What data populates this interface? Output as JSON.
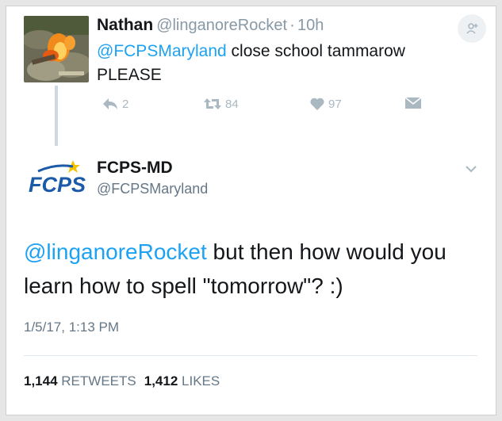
{
  "reply": {
    "name": "Nathan",
    "handle": "@linganoreRocket",
    "separator": "·",
    "time": "10h",
    "mention": "@FCPSMaryland",
    "text": " close school tammarow PLEASE",
    "reply_count": "2",
    "retweet_count": "84",
    "like_count": "97"
  },
  "tweet": {
    "name": "FCPS-MD",
    "handle": "@FCPSMaryland",
    "logo_text": "FCPS",
    "mention": "@linganoreRocket",
    "text": " but then how would you learn how to spell \"tomorrow\"? :)",
    "date": "1/5/17, 1:13 PM",
    "retweets_count": "1,144",
    "retweets_label": "RETWEETS",
    "likes_count": "1,412",
    "likes_label": "LIKES"
  },
  "colors": {
    "link": "#1da1f2",
    "muted": "#657786",
    "icon": "#aab8c2",
    "thread": "#cdd8e0",
    "logo_blue": "#1a5aa8",
    "logo_star": "#f5c400"
  },
  "icons": [
    "reply-icon",
    "retweet-icon",
    "heart-icon",
    "dm-envelope-icon",
    "chevron-down-icon",
    "add-user-icon"
  ]
}
